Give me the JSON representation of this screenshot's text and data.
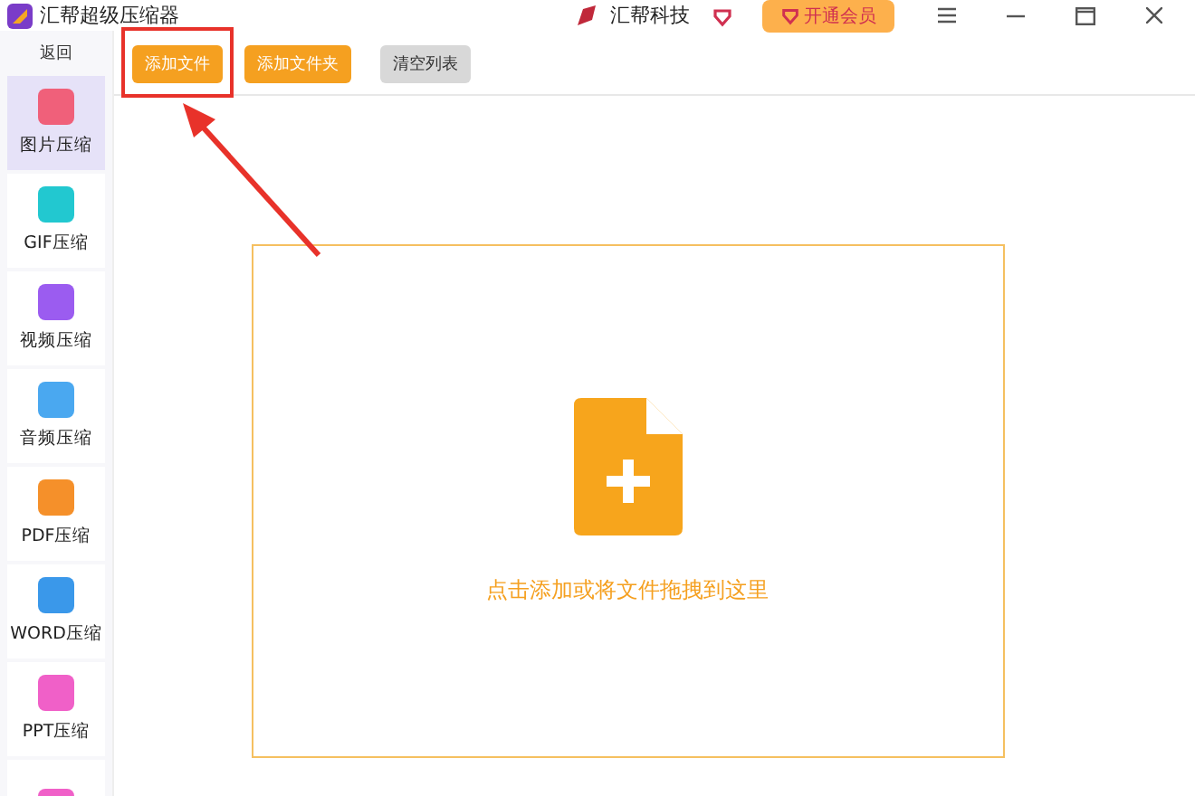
{
  "window": {
    "title": "汇帮超级压缩器",
    "brand": "汇帮科技",
    "vip_button": "开通会员"
  },
  "sidebar": {
    "back": "返回",
    "items": [
      {
        "label": "图片压缩",
        "selected": true,
        "color": "#f0607a"
      },
      {
        "label": "GIF压缩",
        "selected": false,
        "color": "#22c8d0"
      },
      {
        "label": "视频压缩",
        "selected": false,
        "color": "#9b5cf0"
      },
      {
        "label": "音频压缩",
        "selected": false,
        "color": "#4aa8f0"
      },
      {
        "label": "PDF压缩",
        "selected": false,
        "color": "#f5902a"
      },
      {
        "label": "WORD压缩",
        "selected": false,
        "color": "#3a98ea"
      },
      {
        "label": "PPT压缩",
        "selected": false,
        "color": "#f060c8"
      },
      {
        "selected": false,
        "color": "#f060c8"
      }
    ]
  },
  "toolbar": [
    {
      "label": "添加文件",
      "kind": "primary",
      "highlighted": true
    },
    {
      "label": "添加文件夹",
      "kind": "primary",
      "highlighted": false
    },
    {
      "label": "清空列表",
      "kind": "secondary",
      "highlighted": false
    }
  ],
  "drop_zone": {
    "hint": "点击添加或将文件拖拽到这里"
  }
}
